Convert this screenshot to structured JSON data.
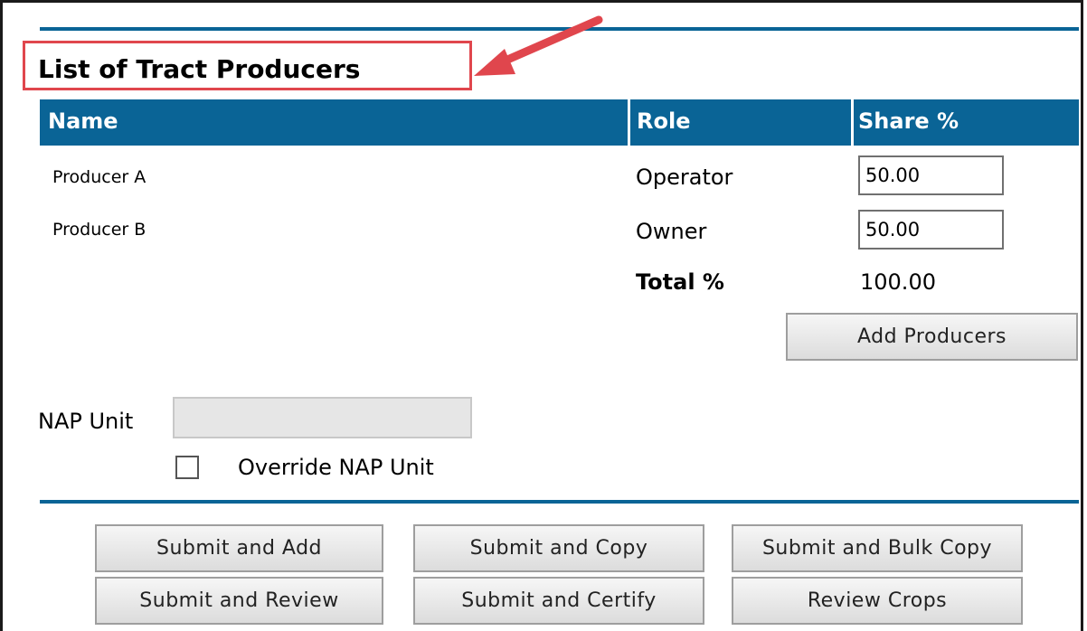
{
  "section_title": "List of Tract Producers",
  "table": {
    "columns": [
      "Name",
      "Role",
      "Share %"
    ],
    "rows": [
      {
        "name": "Producer A",
        "role": "Operator",
        "share": "50.00"
      },
      {
        "name": "Producer B",
        "role": "Owner",
        "share": "50.00"
      }
    ],
    "total_label": "Total %",
    "total_value": "100.00"
  },
  "add_producers_label": "Add Producers",
  "nap_unit": {
    "label": "NAP Unit",
    "value": "",
    "override_label": "Override NAP Unit",
    "override_checked": false
  },
  "actions": [
    "Submit and Add",
    "Submit and Copy",
    "Submit and Bulk Copy",
    "Submit and Review",
    "Submit and Certify",
    "Review Crops"
  ],
  "colors": {
    "header_blue": "#0a6496",
    "annotation_red": "#e0464d"
  },
  "icons": {
    "annotation": "arrow-icon"
  }
}
